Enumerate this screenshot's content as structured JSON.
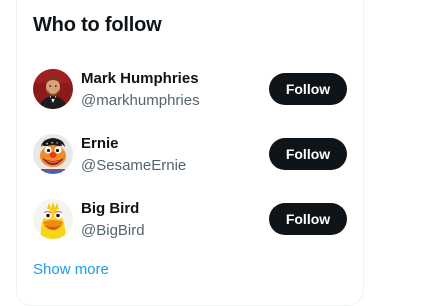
{
  "panel": {
    "title": "Who to follow",
    "show_more_label": "Show more"
  },
  "suggestions": [
    {
      "name": "Mark Humphries",
      "handle": "@markhumphries",
      "button_label": "Follow",
      "avatar_icon": "person-photo-avatar"
    },
    {
      "name": "Ernie",
      "handle": "@SesameErnie",
      "button_label": "Follow",
      "avatar_icon": "ernie-muppet-avatar"
    },
    {
      "name": "Big Bird",
      "handle": "@BigBird",
      "button_label": "Follow",
      "avatar_icon": "big-bird-muppet-avatar"
    }
  ],
  "colors": {
    "button_bg": "#0f1419",
    "link": "#1d9bf0",
    "secondary_text": "#536471",
    "border": "#eff3f4"
  }
}
